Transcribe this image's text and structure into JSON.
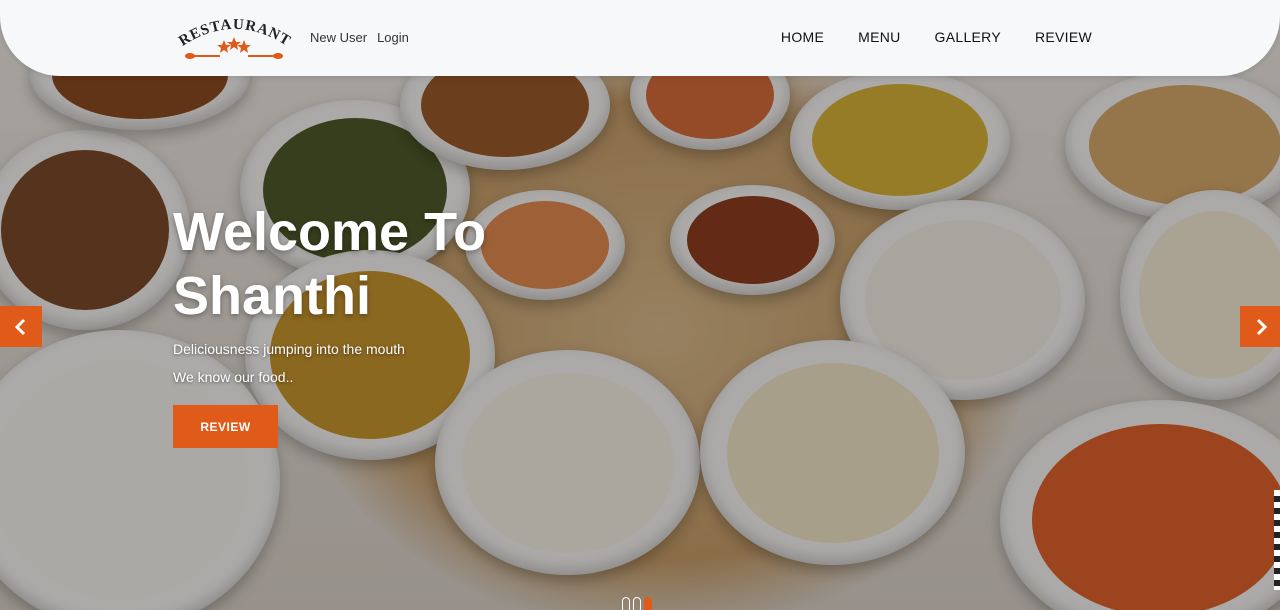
{
  "header": {
    "logo_text": "RESTAURANT",
    "auth": {
      "new_user": "New User",
      "login": "Login"
    },
    "nav": [
      {
        "label": "HOME"
      },
      {
        "label": "MENU"
      },
      {
        "label": "GALLERY"
      },
      {
        "label": "REVIEW"
      }
    ]
  },
  "hero": {
    "title_line1": "Welcome To",
    "title_line2": "Shanthi",
    "subtitle1": "Deliciousness jumping into the mouth",
    "subtitle2": "We know our food..",
    "cta_label": "REVIEW"
  },
  "carousel": {
    "slide_count": 3,
    "active_index": 2
  },
  "colors": {
    "accent": "#e05a1a",
    "header_bg": "#f7f8fa",
    "nav_text": "#111111"
  },
  "icons": {
    "prev": "chevron-left-icon",
    "next": "chevron-right-icon",
    "logo_stars": "star-icon"
  }
}
